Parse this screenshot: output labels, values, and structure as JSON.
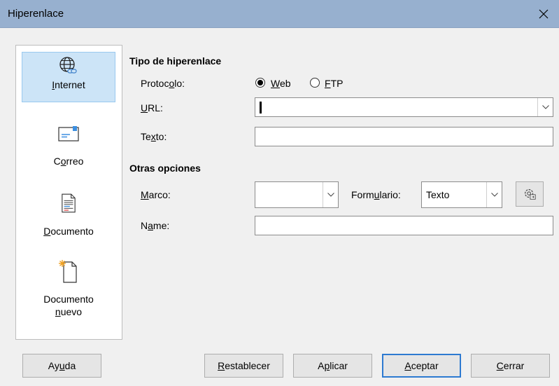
{
  "window": {
    "title": "Hiperenlace"
  },
  "sidebar": {
    "items": [
      {
        "label_pre": "",
        "label_ul": "I",
        "label_post": "nternet",
        "icon": "globe-link-icon"
      },
      {
        "label_pre": "C",
        "label_ul": "o",
        "label_post": "rreo",
        "icon": "mail-icon"
      },
      {
        "label_pre": "",
        "label_ul": "D",
        "label_post": "ocumento",
        "icon": "document-icon"
      },
      {
        "label1": "Documento",
        "label2_pre": "",
        "label2_ul": "n",
        "label2_post": "uevo",
        "icon": "new-document-icon"
      }
    ]
  },
  "hyperlink_type": {
    "title": "Tipo de hiperenlace",
    "protocol_label_pre": "Protoc",
    "protocol_label_ul": "o",
    "protocol_label_post": "lo:",
    "web_ul": "W",
    "web_rest": "eb",
    "ftp_ul": "F",
    "ftp_rest": "TP",
    "selected_protocol": "Web",
    "url_label_ul": "U",
    "url_label_rest": "RL:",
    "url_value": "",
    "text_label_pre": "Te",
    "text_label_ul": "x",
    "text_label_post": "to:",
    "text_value": ""
  },
  "other_options": {
    "title": "Otras opciones",
    "frame_label_ul": "M",
    "frame_label_rest": "arco:",
    "frame_value": "",
    "form_label_pre": "Form",
    "form_label_ul": "u",
    "form_label_post": "lario:",
    "form_value": "Texto",
    "name_label_pre": "N",
    "name_label_ul": "a",
    "name_label_post": "me:",
    "name_value": ""
  },
  "buttons": {
    "help_pre": "Ay",
    "help_ul": "u",
    "help_post": "da",
    "reset_ul": "R",
    "reset_rest": "establecer",
    "apply_pre": "A",
    "apply_ul": "p",
    "apply_post": "licar",
    "ok_ul": "A",
    "ok_rest": "ceptar",
    "close_ul": "C",
    "close_rest": "errar"
  }
}
